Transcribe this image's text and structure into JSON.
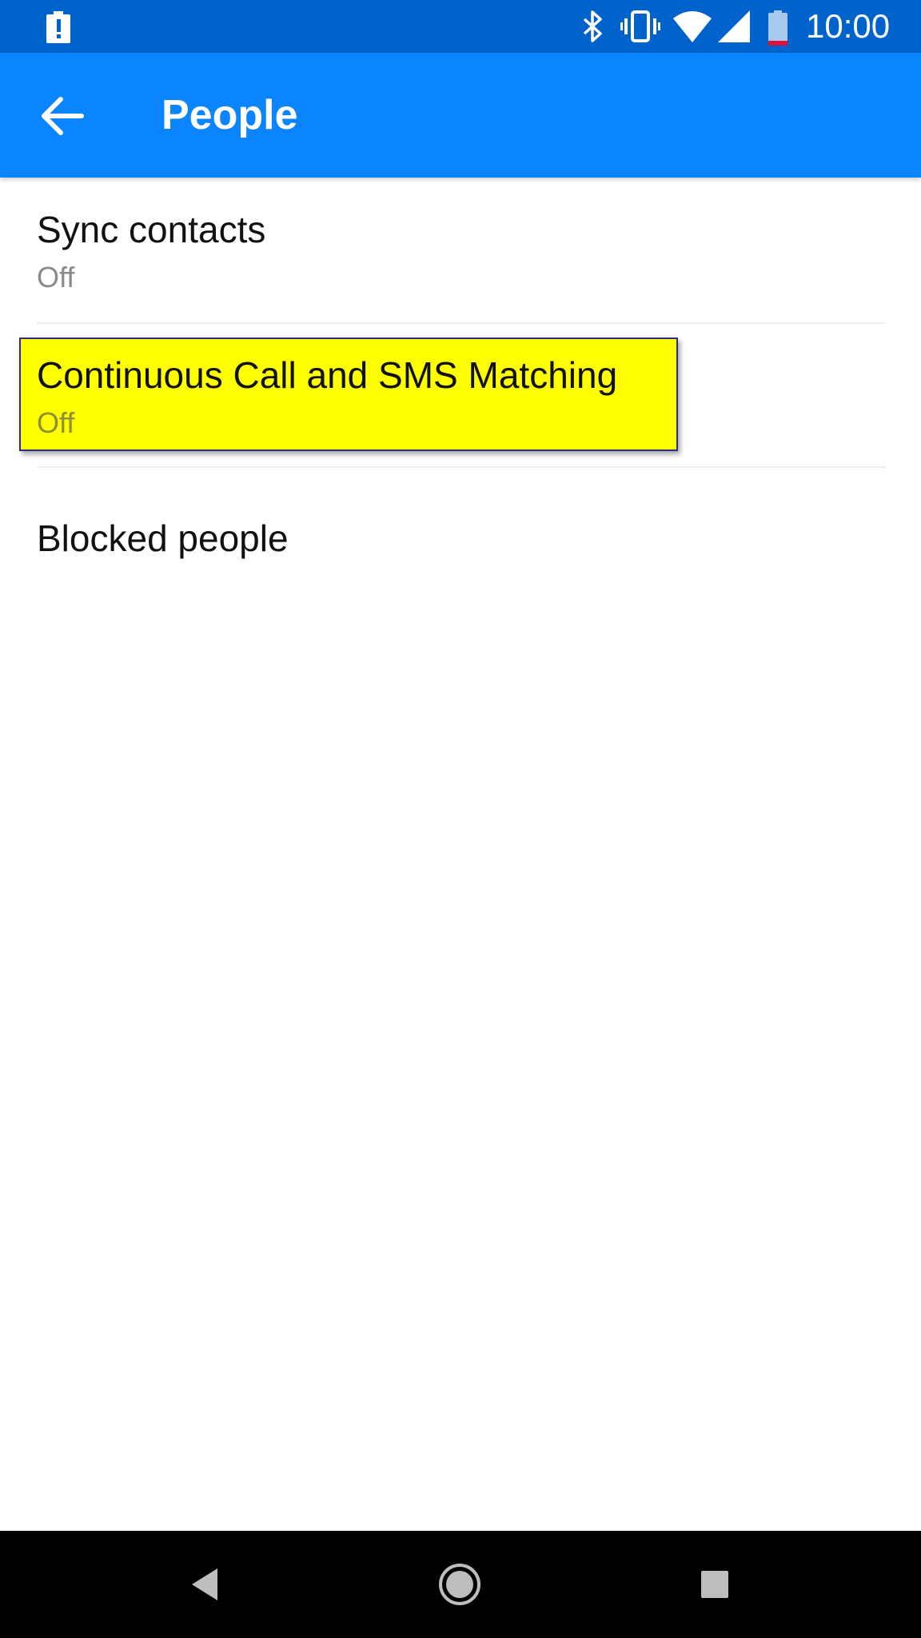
{
  "status_bar": {
    "time": "10:00",
    "icons": [
      "alert-battery-icon",
      "bluetooth-icon",
      "vibrate-icon",
      "wifi-icon",
      "cellular-signal-icon",
      "battery-low-icon"
    ],
    "background_color": "#0063cc"
  },
  "app_bar": {
    "title": "People",
    "back_icon": "back-arrow-icon",
    "background_color": "#0a84ff"
  },
  "settings": [
    {
      "title": "Sync contacts",
      "summary": "Off"
    },
    {
      "title": "Continuous Call and SMS Matching",
      "summary": "Off",
      "highlighted": true,
      "highlight_color": "#ffff00"
    },
    {
      "title": "Blocked people"
    }
  ],
  "nav_bar": {
    "buttons": [
      "back-triangle-icon",
      "home-circle-icon",
      "recents-square-icon"
    ],
    "background_color": "#000000"
  }
}
